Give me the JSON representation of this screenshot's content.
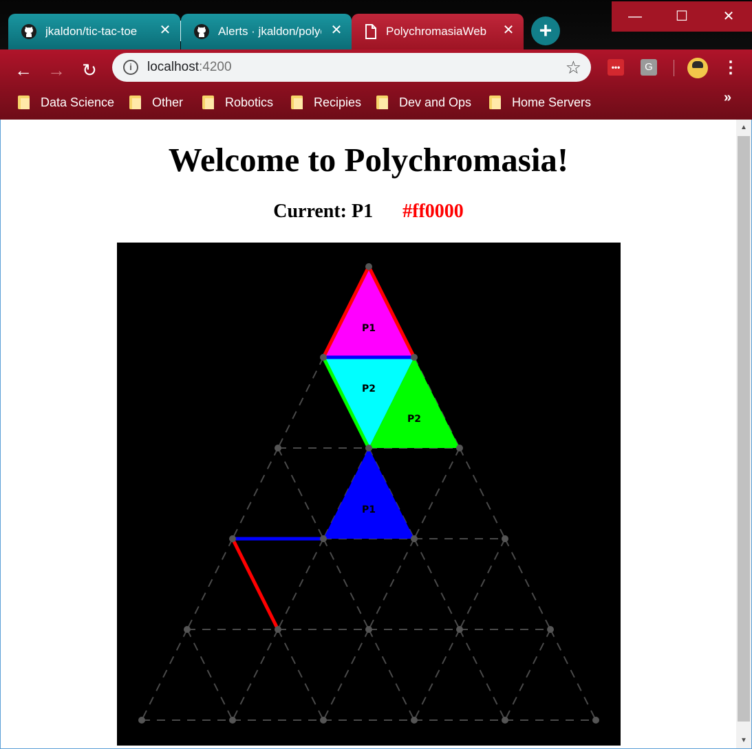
{
  "browser": {
    "tabs": [
      {
        "title": "jkaldon/tic-tac-toe",
        "icon": "github-icon"
      },
      {
        "title": "Alerts · jkaldon/polychromasia",
        "icon": "github-icon"
      },
      {
        "title": "PolychromasiaWeb",
        "icon": "document-icon"
      }
    ],
    "address": {
      "host": "localhost",
      "port": ":4200"
    },
    "bookmarks": [
      "Data Science",
      "Other",
      "Robotics",
      "Recipies",
      "Dev and Ops",
      "Home Servers"
    ],
    "extension_badge": "•••",
    "extension_g": "G"
  },
  "page": {
    "title": "Welcome to Polychromasia!",
    "current_player": "Current: P1",
    "current_color": "#ff0000"
  },
  "board": {
    "rows": 5,
    "filled_triangles": [
      {
        "row": 1,
        "pos": 0,
        "up": true,
        "color": "#ff00ff",
        "label": "P1"
      },
      {
        "row": 2,
        "pos": 0,
        "up": false,
        "color": "#00ffff",
        "label": "P2"
      },
      {
        "row": 2,
        "pos": 1,
        "up": true,
        "color": "#00ff00",
        "label": "P2"
      },
      {
        "row": 3,
        "pos": 1,
        "up": true,
        "color": "#0000ff",
        "label": "P1"
      }
    ],
    "claimed_edges": [
      {
        "from": [
          0,
          0
        ],
        "to": [
          1,
          0
        ],
        "color": "#ff0000"
      },
      {
        "from": [
          0,
          0
        ],
        "to": [
          1,
          1
        ],
        "color": "#ff0000"
      },
      {
        "from": [
          1,
          0
        ],
        "to": [
          1,
          1
        ],
        "color": "#0000ff"
      },
      {
        "from": [
          1,
          0
        ],
        "to": [
          2,
          1
        ],
        "color": "#00ff00"
      },
      {
        "from": [
          3,
          0
        ],
        "to": [
          3,
          1
        ],
        "color": "#0000ff"
      },
      {
        "from": [
          3,
          0
        ],
        "to": [
          4,
          1
        ],
        "color": "#ff0000"
      }
    ]
  }
}
